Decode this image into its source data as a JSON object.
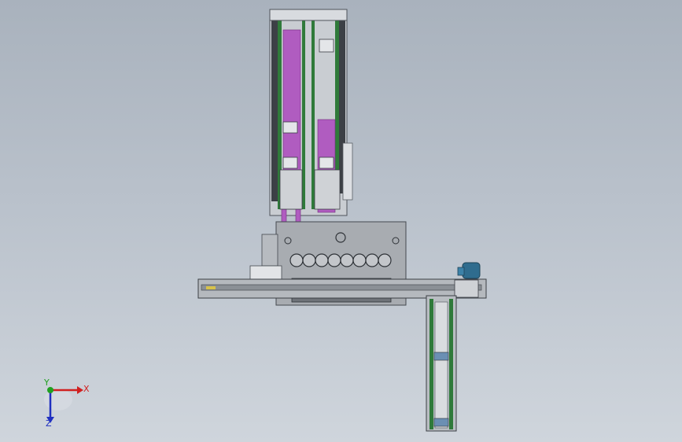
{
  "viewport": {
    "background_top": "#a9b2bd",
    "background_bottom": "#cfd5dc"
  },
  "model": {
    "part_colors": {
      "frame_gray": "#9a9ea3",
      "frame_dark": "#5a5f66",
      "magenta_plate": "#b05cc0",
      "green_rail": "#2f7a3a",
      "blue_motor": "#2f6c8e",
      "yellow_detail": "#d7c24a"
    }
  },
  "triad": {
    "x_label": "X",
    "y_label": "Y",
    "z_label": "Z",
    "x_color": "#d02020",
    "y_color": "#20a020",
    "z_color": "#2030c0"
  }
}
